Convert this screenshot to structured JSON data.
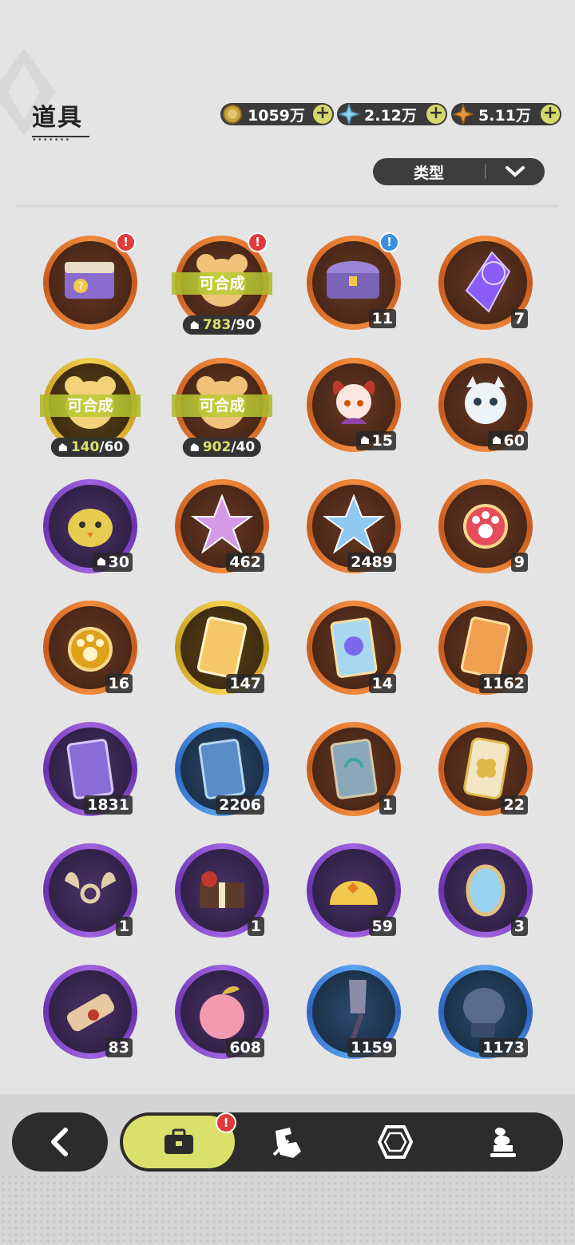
{
  "header": {
    "title": "道具"
  },
  "currencies": [
    {
      "value": "1059万",
      "icon": "gold-coin-icon",
      "color": "#c9a13b"
    },
    {
      "value": "2.12万",
      "icon": "crystal-icon",
      "color": "#8fd1e8"
    },
    {
      "value": "5.11万",
      "icon": "star-shard-icon",
      "color": "#e59a3a"
    }
  ],
  "filter": {
    "label": "类型"
  },
  "items": [
    {
      "name": "purple-chest-question",
      "ring": "orange",
      "badge": "!",
      "badge_color": "red"
    },
    {
      "name": "orange-pup-synth",
      "ring": "orange",
      "badge": "!",
      "badge_color": "red",
      "synth": "可合成",
      "frag_have": "783",
      "frag_need": "/90"
    },
    {
      "name": "purple-chest",
      "ring": "orange",
      "badge": "!",
      "badge_color": "blue",
      "count": "11"
    },
    {
      "name": "purple-crystal",
      "ring": "orange",
      "count": "7"
    },
    {
      "name": "yellow-pup-synth",
      "ring": "gold",
      "synth": "可合成",
      "frag_have": "140",
      "frag_need": "/60"
    },
    {
      "name": "orange-pup-synth-2",
      "ring": "orange",
      "synth": "可合成",
      "frag_have": "902",
      "frag_need": "/40"
    },
    {
      "name": "cat-girl-fragment",
      "ring": "orange",
      "count": "15",
      "frag": true
    },
    {
      "name": "white-cat-fragment",
      "ring": "orange",
      "count": "60",
      "frag": true
    },
    {
      "name": "yellow-bird-fragment",
      "ring": "purple",
      "count": "30",
      "frag": true
    },
    {
      "name": "pink-star-crystal",
      "ring": "orange",
      "count": "462"
    },
    {
      "name": "blue-star-crystal",
      "ring": "orange",
      "count": "2489"
    },
    {
      "name": "red-paw-charm",
      "ring": "orange",
      "count": "9"
    },
    {
      "name": "gold-paw-charm",
      "ring": "orange",
      "count": "16"
    },
    {
      "name": "gold-card",
      "ring": "gold",
      "count": "147"
    },
    {
      "name": "holo-card",
      "ring": "orange",
      "count": "14"
    },
    {
      "name": "orange-card",
      "ring": "orange",
      "count": "1162"
    },
    {
      "name": "purple-card",
      "ring": "purple",
      "count": "1831"
    },
    {
      "name": "blue-card",
      "ring": "blue",
      "count": "2206"
    },
    {
      "name": "recycle-card",
      "ring": "orange",
      "count": "1"
    },
    {
      "name": "clover-ticket",
      "ring": "orange",
      "count": "22"
    },
    {
      "name": "horn-ornament",
      "ring": "purple",
      "count": "1"
    },
    {
      "name": "gift-box",
      "ring": "purple",
      "count": "1"
    },
    {
      "name": "gold-helmet",
      "ring": "purple",
      "count": "59"
    },
    {
      "name": "magic-mirror",
      "ring": "purple",
      "count": "3"
    },
    {
      "name": "scroll",
      "ring": "purple",
      "count": "83"
    },
    {
      "name": "pink-apple",
      "ring": "purple",
      "count": "608"
    },
    {
      "name": "shovel",
      "ring": "blue",
      "count": "1159"
    },
    {
      "name": "boxing-glove",
      "ring": "blue",
      "count": "1173"
    }
  ],
  "bottom_nav": {
    "tabs": [
      "bag-icon",
      "equipment-icon",
      "gem-icon",
      "dessert-icon"
    ],
    "badge": "!"
  }
}
